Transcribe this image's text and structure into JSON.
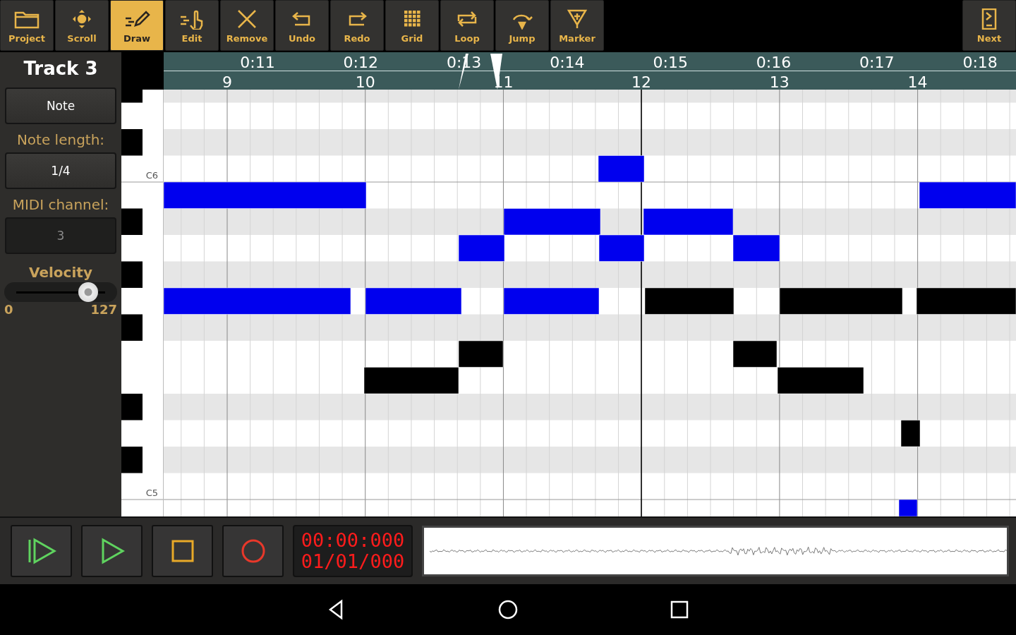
{
  "toolbar": {
    "tools": [
      {
        "label": "Project",
        "selected": false
      },
      {
        "label": "Scroll",
        "selected": false
      },
      {
        "label": "Draw",
        "selected": true
      },
      {
        "label": "Edit",
        "selected": false
      },
      {
        "label": "Remove",
        "selected": false
      },
      {
        "label": "Undo",
        "selected": false
      },
      {
        "label": "Redo",
        "selected": false
      },
      {
        "label": "Grid",
        "selected": false
      },
      {
        "label": "Loop",
        "selected": false
      },
      {
        "label": "Jump",
        "selected": false
      },
      {
        "label": "Marker",
        "selected": false
      }
    ],
    "next": {
      "label": "Next"
    }
  },
  "track_panel": {
    "title": "Track 3",
    "mode_button": "Note",
    "note_length": {
      "label": "Note length:",
      "value": "1/4"
    },
    "midi_channel": {
      "label": "MIDI channel:",
      "value": "3",
      "disabled": true
    },
    "velocity": {
      "label": "Velocity",
      "level": 0.81,
      "min": "0",
      "max": "127"
    }
  },
  "ruler": {
    "times": [
      "0:11",
      "0:12",
      "0:13",
      "0:14",
      "0:15",
      "0:16",
      "0:17",
      "0:18"
    ],
    "bars": [
      "9",
      "10",
      "11",
      "12",
      "13",
      "14"
    ]
  },
  "keyboard": {
    "labels": [
      "C6",
      "C5"
    ]
  },
  "transport": {
    "time": "00:00:000",
    "position": "01/01/000"
  }
}
